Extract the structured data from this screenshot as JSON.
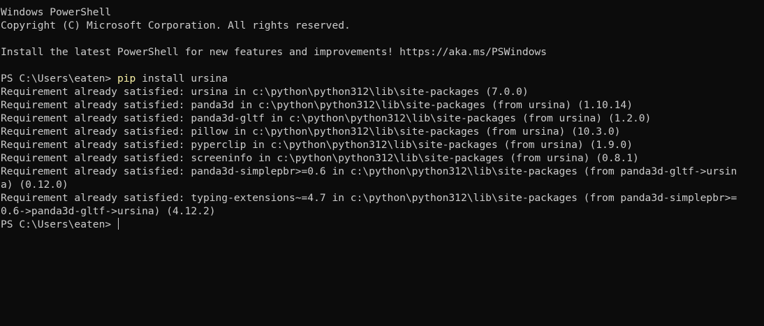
{
  "header": {
    "title_line": "Windows PowerShell",
    "copyright_line": "Copyright (C) Microsoft Corporation. All rights reserved.",
    "install_notice": "Install the latest PowerShell for new features and improvements! https://aka.ms/PSWindows"
  },
  "session": {
    "prompt": "PS C:\\Users\\eaten> ",
    "command_name": "pip",
    "command_args": " install ursina",
    "output": [
      "Requirement already satisfied: ursina in c:\\python\\python312\\lib\\site-packages (7.0.0)",
      "Requirement already satisfied: panda3d in c:\\python\\python312\\lib\\site-packages (from ursina) (1.10.14)",
      "Requirement already satisfied: panda3d-gltf in c:\\python\\python312\\lib\\site-packages (from ursina) (1.2.0)",
      "Requirement already satisfied: pillow in c:\\python\\python312\\lib\\site-packages (from ursina) (10.3.0)",
      "Requirement already satisfied: pyperclip in c:\\python\\python312\\lib\\site-packages (from ursina) (1.9.0)",
      "Requirement already satisfied: screeninfo in c:\\python\\python312\\lib\\site-packages (from ursina) (0.8.1)",
      "Requirement already satisfied: panda3d-simplepbr>=0.6 in c:\\python\\python312\\lib\\site-packages (from panda3d-gltf->ursin",
      "a) (0.12.0)",
      "Requirement already satisfied: typing-extensions~=4.7 in c:\\python\\python312\\lib\\site-packages (from panda3d-simplepbr>=",
      "0.6->panda3d-gltf->ursina) (4.12.2)"
    ],
    "final_prompt": "PS C:\\Users\\eaten> "
  },
  "colors": {
    "background": "#0c0c0c",
    "foreground": "#cccccc",
    "command_highlight": "#f9f1a5"
  }
}
